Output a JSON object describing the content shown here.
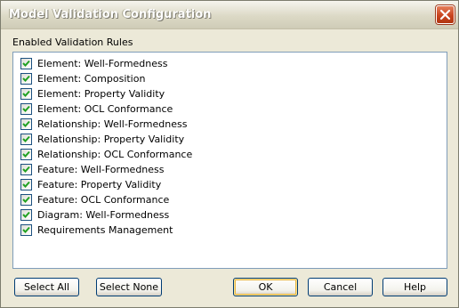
{
  "window": {
    "title": "Model Validation Configuration"
  },
  "section": {
    "label": "Enabled Validation Rules"
  },
  "rules": [
    {
      "label": "Element: Well-Formedness",
      "checked": true
    },
    {
      "label": "Element: Composition",
      "checked": true
    },
    {
      "label": "Element: Property Validity",
      "checked": true
    },
    {
      "label": "Element: OCL Conformance",
      "checked": true
    },
    {
      "label": "Relationship: Well-Formedness",
      "checked": true
    },
    {
      "label": "Relationship: Property Validity",
      "checked": true
    },
    {
      "label": "Relationship: OCL Conformance",
      "checked": true
    },
    {
      "label": "Feature: Well-Formedness",
      "checked": true
    },
    {
      "label": "Feature: Property Validity",
      "checked": true
    },
    {
      "label": "Feature: OCL Conformance",
      "checked": true
    },
    {
      "label": "Diagram: Well-Formedness",
      "checked": true
    },
    {
      "label": "Requirements Management",
      "checked": true
    }
  ],
  "buttons": {
    "select_all": "Select All",
    "select_none": "Select None",
    "ok": "OK",
    "cancel": "Cancel",
    "help": "Help"
  },
  "icons": {
    "close": "close-icon",
    "check": "check-icon"
  },
  "colors": {
    "check": "#21a121",
    "close_button": "#c9441f",
    "list_border": "#7f9db9"
  }
}
